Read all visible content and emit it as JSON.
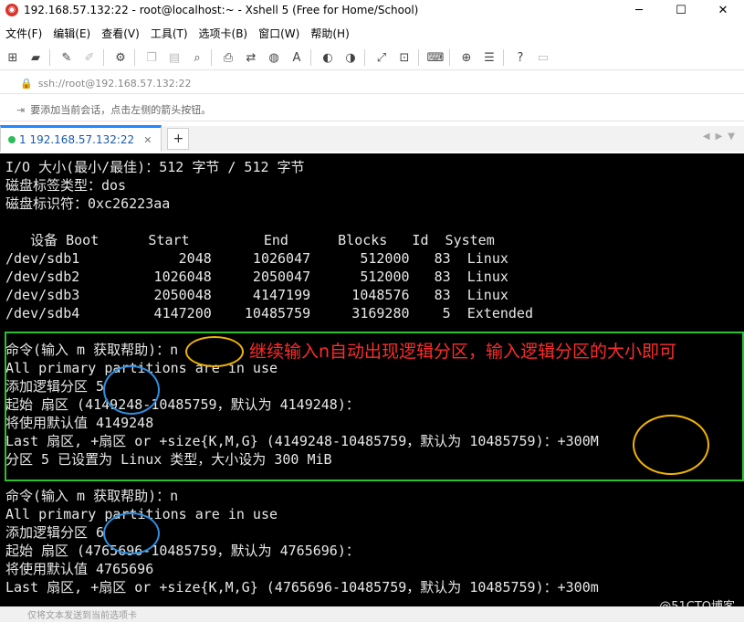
{
  "window": {
    "title": "192.168.57.132:22 - root@localhost:~ - Xshell 5 (Free for Home/School)",
    "minimize": "─",
    "maximize": "☐",
    "close": "✕"
  },
  "menu": [
    "文件(F)",
    "编辑(E)",
    "查看(V)",
    "工具(T)",
    "选项卡(B)",
    "窗口(W)",
    "帮助(H)"
  ],
  "address": {
    "url": "ssh://root@192.168.57.132:22"
  },
  "hint": {
    "text": "要添加当前会话，点击左侧的箭头按钮。"
  },
  "tab": {
    "label": "1 192.168.57.132:22",
    "close": "✕",
    "add": "+"
  },
  "terminal": {
    "lines": [
      "I/O 大小(最小/最佳)：512 字节 / 512 字节",
      "磁盘标签类型：dos",
      "磁盘标识符：0xc26223aa",
      "",
      "   设备 Boot      Start         End      Blocks   Id  System",
      "/dev/sdb1            2048     1026047      512000   83  Linux",
      "/dev/sdb2         1026048     2050047      512000   83  Linux",
      "/dev/sdb3         2050048     4147199     1048576   83  Linux",
      "/dev/sdb4         4147200    10485759     3169280    5  Extended",
      "",
      "命令(输入 m 获取帮助)：n",
      "All primary partitions are in use",
      "添加逻辑分区 5",
      "起始 扇区 (4149248-10485759，默认为 4149248)：",
      "将使用默认值 4149248",
      "Last 扇区, +扇区 or +size{K,M,G} (4149248-10485759，默认为 10485759)：+300M",
      "分区 5 已设置为 Linux 类型，大小设为 300 MiB",
      "",
      "命令(输入 m 获取帮助)：n",
      "All primary partitions are in use",
      "添加逻辑分区 6",
      "起始 扇区 (4765696-10485759，默认为 4765696)：",
      "将使用默认值 4765696",
      "Last 扇区, +扇区 or +size{K,M,G} (4765696-10485759，默认为 10485759)：+300m"
    ],
    "annotation": "继续输入n自动出现逻辑分区，输入逻辑分区的大小即可",
    "colors": {
      "box": "#2fbf2f",
      "annotation": "#ff2b2b",
      "orange_circle": "#f0b400",
      "blue_circle": "#2e8fe0"
    }
  },
  "watermark": "@51CTO博客",
  "status": {
    "text": "仅将文本发送到当前选项卡"
  },
  "icons": [
    "new-session-icon",
    "open-folder-icon",
    "link-icon",
    "unlink-icon",
    "properties-icon",
    "copy-icon",
    "paste-icon",
    "find-icon",
    "print-icon",
    "transfer-icon",
    "globe-icon",
    "font-icon",
    "xshell-icon",
    "xftp-icon",
    "fullscreen-icon",
    "lock-icon",
    "keyboard-icon",
    "add-icon",
    "help-icon",
    "chat-icon"
  ]
}
